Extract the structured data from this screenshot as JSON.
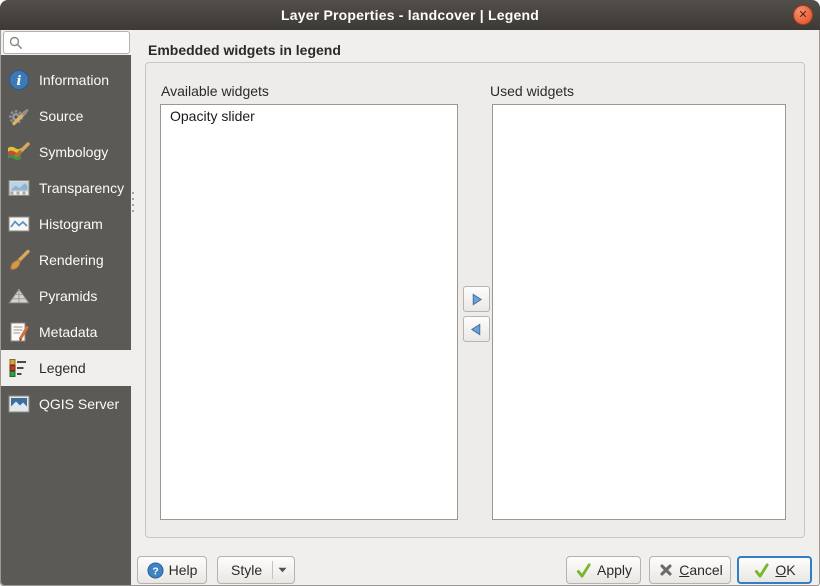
{
  "window": {
    "title": "Layer Properties - landcover | Legend",
    "close_glyph": "✕"
  },
  "search": {
    "value": ""
  },
  "sidebar": {
    "items": [
      {
        "label": "Information",
        "icon": "information-icon"
      },
      {
        "label": "Source",
        "icon": "source-icon"
      },
      {
        "label": "Symbology",
        "icon": "symbology-icon"
      },
      {
        "label": "Transparency",
        "icon": "transparency-icon"
      },
      {
        "label": "Histogram",
        "icon": "histogram-icon"
      },
      {
        "label": "Rendering",
        "icon": "rendering-icon"
      },
      {
        "label": "Pyramids",
        "icon": "pyramids-icon"
      },
      {
        "label": "Metadata",
        "icon": "metadata-icon"
      },
      {
        "label": "Legend",
        "icon": "legend-icon",
        "selected": true
      },
      {
        "label": "QGIS Server",
        "icon": "qgis-server-icon"
      }
    ]
  },
  "main": {
    "group_title": "Embedded widgets in legend",
    "available": {
      "label": "Available widgets",
      "items": [
        "Opacity slider"
      ]
    },
    "used": {
      "label": "Used widgets",
      "items": []
    }
  },
  "footer": {
    "help_label": "Help",
    "style_label": "Style",
    "apply_label": "Apply",
    "cancel_mnemonic": "C",
    "cancel_rest": "ancel",
    "ok_mnemonic": "O",
    "ok_rest": "K"
  },
  "colors": {
    "titlebar_top": "#524e49",
    "titlebar_bottom": "#3d3a36",
    "sidebar_bg": "#5c5a57",
    "dialog_bg": "#f0efed",
    "selected_row_bg": "#f0efed",
    "accent_blue": "#2f7ec7",
    "close_orange": "#ec6540",
    "check_green": "#76b82a"
  }
}
